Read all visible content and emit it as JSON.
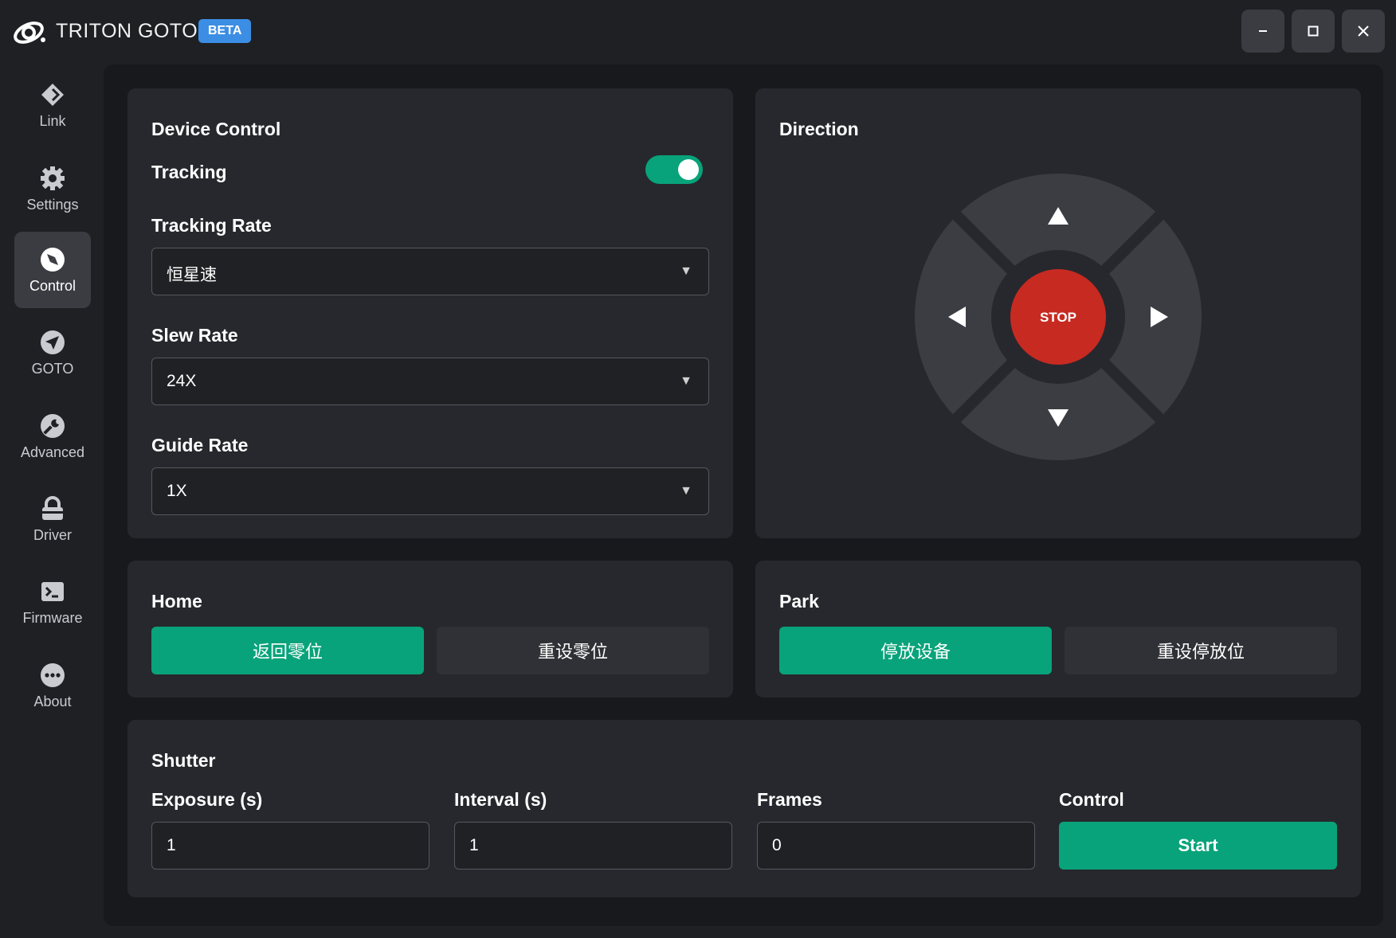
{
  "app": {
    "title": "TRITON GOTO",
    "badge": "BETA"
  },
  "window_controls": {
    "minimize": "minimize-icon",
    "maximize": "maximize-icon",
    "close": "close-icon"
  },
  "sidebar": {
    "items": [
      {
        "label": "Link",
        "icon": "link-icon"
      },
      {
        "label": "Settings",
        "icon": "gear-icon"
      },
      {
        "label": "Control",
        "icon": "control-icon",
        "active": true
      },
      {
        "label": "GOTO",
        "icon": "navigation-icon"
      },
      {
        "label": "Advanced",
        "icon": "wrench-icon"
      },
      {
        "label": "Driver",
        "icon": "lock-icon"
      },
      {
        "label": "Firmware",
        "icon": "terminal-icon"
      },
      {
        "label": "About",
        "icon": "more-icon"
      }
    ]
  },
  "device_control": {
    "title": "Device Control",
    "tracking_label": "Tracking",
    "tracking_on": true,
    "tracking_rate_label": "Tracking Rate",
    "tracking_rate_value": "恒星速",
    "slew_rate_label": "Slew Rate",
    "slew_rate_value": "24X",
    "guide_rate_label": "Guide Rate",
    "guide_rate_value": "1X"
  },
  "direction": {
    "title": "Direction",
    "stop_label": "STOP"
  },
  "home": {
    "title": "Home",
    "return_label": "返回零位",
    "reset_label": "重设零位"
  },
  "park": {
    "title": "Park",
    "park_label": "停放设备",
    "reset_label": "重设停放位"
  },
  "shutter": {
    "title": "Shutter",
    "exposure_label": "Exposure (s)",
    "exposure_value": "1",
    "interval_label": "Interval (s)",
    "interval_value": "1",
    "frames_label": "Frames",
    "frames_value": "0",
    "control_label": "Control",
    "start_label": "Start"
  },
  "colors": {
    "accent": "#08a37a",
    "stop": "#c72a21",
    "beta": "#3b8ee4"
  }
}
